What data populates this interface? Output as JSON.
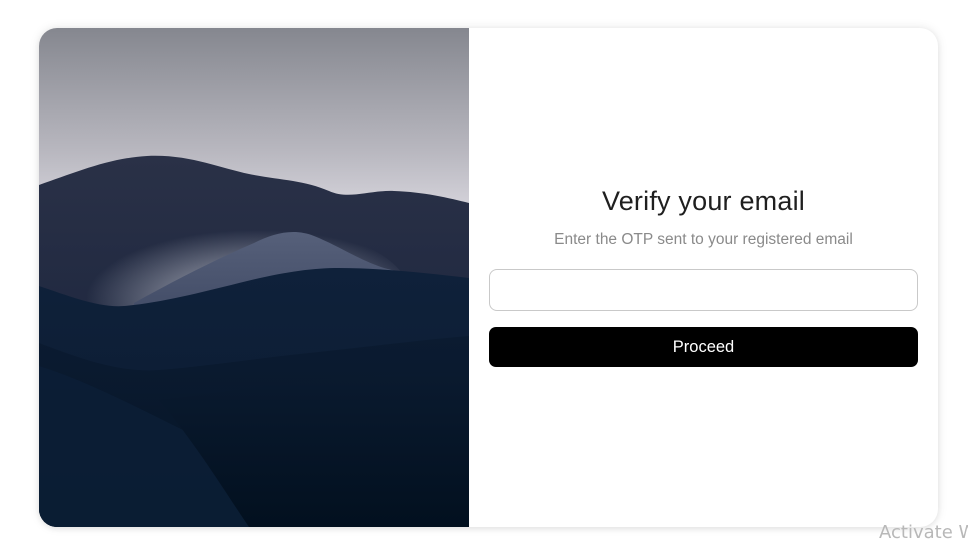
{
  "verify": {
    "title": "Verify your email",
    "subtitle": "Enter the OTP sent to your registered email",
    "otp_value": "",
    "proceed_label": "Proceed"
  },
  "watermark": {
    "text": "Activate W"
  },
  "colors": {
    "button_bg": "#000000",
    "button_text": "#ffffff",
    "subtitle": "#8a8a8a",
    "title": "#1f1f1f",
    "input_border": "#c9c9c9",
    "hero_sky_top": "#8a8c96",
    "hero_sky_glow": "#dedce4",
    "hero_dark": "#02111f"
  }
}
